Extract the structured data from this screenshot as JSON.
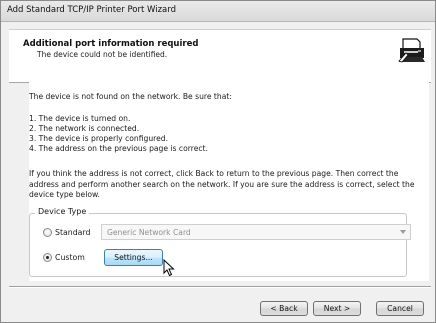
{
  "window": {
    "title": "Add Standard TCP/IP Printer Port Wizard"
  },
  "header": {
    "title": "Additional port information required",
    "subtitle": "The device could not be identified.",
    "icon": "printer-icon"
  },
  "content": {
    "intro": "The device is not found on the network.  Be sure that:",
    "checklist": [
      "1.  The device is turned on.",
      "2.  The network is connected.",
      "3.  The device is properly configured.",
      "4.  The address on the previous page is correct."
    ],
    "instructions": "If you think the address is not correct, click Back to return to the previous page.  Then correct the address and perform another search on the network.  If you are sure the address is correct, select the device type below."
  },
  "device_type": {
    "legend": "Device Type",
    "standard_label": "Standard",
    "standard_selected": false,
    "standard_dropdown_value": "Generic Network Card",
    "custom_label": "Custom",
    "custom_selected": true,
    "settings_button": "Settings..."
  },
  "footer": {
    "back_button": "< Back",
    "next_button": "Next >",
    "cancel_button": "Cancel"
  }
}
